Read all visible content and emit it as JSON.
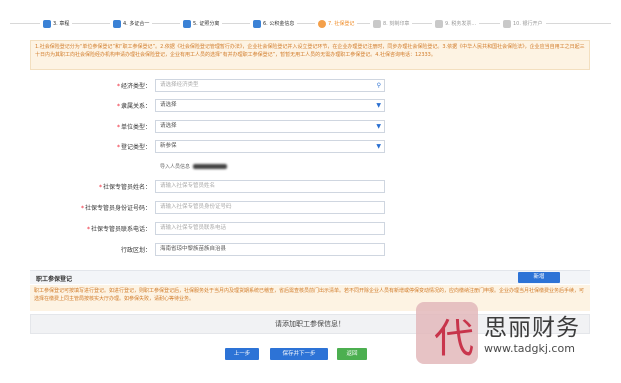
{
  "steps": [
    {
      "label": "3. 章程",
      "state": "done"
    },
    {
      "label": "4. 多证合一",
      "state": "done"
    },
    {
      "label": "5. 证照分离",
      "state": "done"
    },
    {
      "label": "6. 公积金信息",
      "state": "done"
    },
    {
      "label": "7. 社保登记",
      "state": "current"
    },
    {
      "label": "8. 刻制印章",
      "state": "todo"
    },
    {
      "label": "9. 税务发票...",
      "state": "todo"
    },
    {
      "label": "10. 银行开户",
      "state": "todo"
    }
  ],
  "notice": "1.社会保险登记分为“单位参保登记”和“职工参保登记”。2.依据《社会保险登记管理暂行办法》，企业社会保险登记并入设立登记环节，在企业办理登记注册时，同步办理社会保险登记。3.依据《中华人民共和国社会保险法》，企业应当自用工之日起三十日内为其职工向社会保险经办机构申请办理社会保险登记，企业有用工人员的选择“有并办理职工参保登记”，暂暂无用工人员的无需办理职工参保登记。4.社保咨询电话：12333。",
  "form": {
    "economy_type": {
      "label": "经济类型：",
      "placeholder": "请选择经济类型"
    },
    "affiliation": {
      "label": "隶属关系：",
      "value": "请选择"
    },
    "unit_type": {
      "label": "单位类型：",
      "value": "请选择"
    },
    "reg_type": {
      "label": "登记类型：",
      "value": "新参保"
    },
    "import_hint": "导入人员信息",
    "manager_name": {
      "label": "社保专管员姓名：",
      "placeholder": "请输入社保专管员姓名"
    },
    "manager_id": {
      "label": "社保专管员身份证号码：",
      "placeholder": "请输入社保专管员身份证号码"
    },
    "manager_phone": {
      "label": "社保专管员联系电话：",
      "placeholder": "请输入社保专管员联系电话"
    },
    "region": {
      "label": "行政区划：",
      "value": "海南省琼中黎族苗族自治县"
    }
  },
  "section": {
    "title": "职工参保登记",
    "add_label": "新增",
    "note": "职工参保登记可按填写进行登记。如进行登记，则职工参保登记后，社保服务处于当月内及理货期系统已稽查，省后需查核员前门出示清单。若不同开除企业人员有新增或停保变动情况的，应向缴纳注册门申报。企业办理当月社保缴费业务后手续，可选择在缴费上同主管局按核实大厅办理。如参保失败，请耐心等待业务。",
    "empty_text": "请添加职工参保信息！"
  },
  "buttons": {
    "prev": "上一步",
    "save": "保存并下一步",
    "back": "返回"
  },
  "watermark": {
    "logo_char": "代",
    "name": "思丽财务",
    "url": "www.tadgkj.com"
  },
  "colors": {
    "accent": "#2d73d6",
    "orange": "#f08a24",
    "green": "#4caf50"
  }
}
